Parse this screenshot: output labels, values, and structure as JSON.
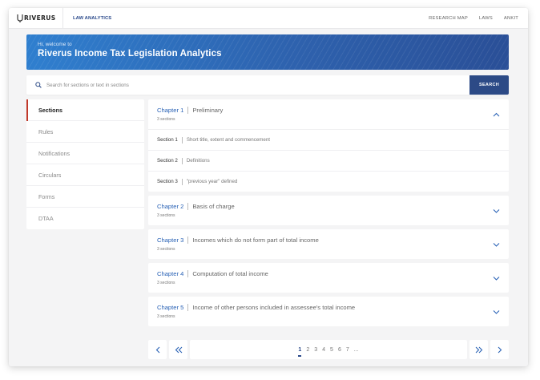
{
  "app": {
    "logo_text": "RIVERUS",
    "brand_link": "LAW ANALYTICS",
    "nav": [
      "RESEARCH MAP",
      "LAWS",
      "ANKIT"
    ]
  },
  "banner": {
    "greeting": "Hi, welcome to",
    "title": "Riverus Income Tax Legislation Analytics"
  },
  "search": {
    "placeholder": "Search for sections or text in sections",
    "button_label": "SEARCH"
  },
  "sidebar": {
    "items": [
      {
        "label": "Sections",
        "active": true
      },
      {
        "label": "Rules"
      },
      {
        "label": "Notifications"
      },
      {
        "label": "Circulars"
      },
      {
        "label": "Forms"
      },
      {
        "label": "DTAA"
      }
    ]
  },
  "chapters": [
    {
      "number": "Chapter 1",
      "title": "Preliminary",
      "count": "3 sections",
      "expanded": true,
      "sections": [
        {
          "number": "Section 1",
          "title": "Short title, extent and commencement"
        },
        {
          "number": "Section 2",
          "title": "Definitions"
        },
        {
          "number": "Section 3",
          "title": "\"previous year\" defined"
        }
      ]
    },
    {
      "number": "Chapter 2",
      "title": "Basis of charge",
      "count": "3 sections",
      "expanded": false
    },
    {
      "number": "Chapter 3",
      "title": "Incomes which do not form part of total income",
      "count": "3 sections",
      "expanded": false
    },
    {
      "number": "Chapter 4",
      "title": "Computation of total income",
      "count": "3 sections",
      "expanded": false
    },
    {
      "number": "Chapter 5",
      "title": "Income of other persons included in assessee's total income",
      "count": "3 sections",
      "expanded": false
    }
  ],
  "pagination": {
    "pages": [
      "1",
      "2",
      "3",
      "4",
      "5",
      "6",
      "7",
      "..."
    ],
    "current": "1"
  },
  "colors": {
    "accent": "#2b63b6",
    "brand_dark": "#2c4a86",
    "active_marker": "#c0392b"
  },
  "icons": {
    "search": "search-icon",
    "expand": "chevron-down-icon",
    "collapse": "chevron-up-icon",
    "prev": "chevron-left-icon",
    "first": "double-chevron-left-icon",
    "last": "double-chevron-right-icon",
    "next": "chevron-right-icon"
  }
}
